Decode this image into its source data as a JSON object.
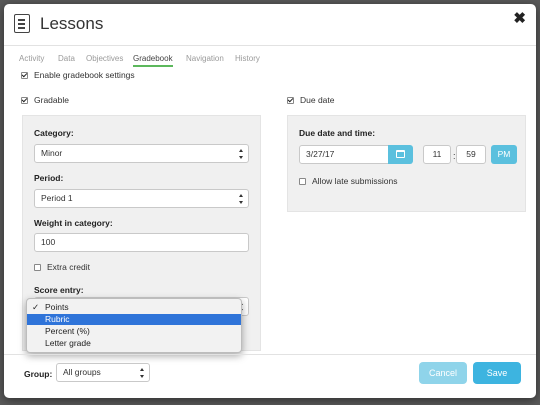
{
  "header": {
    "title": "Lessons",
    "close": "✖"
  },
  "tabs": [
    {
      "label": "Activity"
    },
    {
      "label": "Data"
    },
    {
      "label": "Objectives"
    },
    {
      "label": "Gradebook"
    },
    {
      "label": "Navigation"
    },
    {
      "label": "History"
    }
  ],
  "active_tab": "Gradebook",
  "settings": {
    "enable_gradebook": {
      "label": "Enable gradebook settings",
      "checked": true
    },
    "gradable": {
      "label": "Gradable",
      "checked": true
    },
    "due_date": {
      "label": "Due date",
      "checked": true
    }
  },
  "gradable_panel": {
    "category_label": "Category:",
    "category_value": "Minor",
    "period_label": "Period:",
    "period_value": "Period 1",
    "weight_label": "Weight in category:",
    "weight_value": "100",
    "extra_credit": {
      "label": "Extra credit",
      "checked": false
    },
    "score_entry_label": "Score entry:",
    "score_options": [
      {
        "label": "Points",
        "checked": true
      },
      {
        "label": "Rubric",
        "highlighted": true
      },
      {
        "label": "Percent (%)"
      },
      {
        "label": "Letter grade"
      }
    ]
  },
  "due_panel": {
    "label": "Due date and time:",
    "date": "3/27/17",
    "hour": "11",
    "minute": "59",
    "ampm": "PM",
    "allow_late": {
      "label": "Allow late submissions",
      "checked": false
    }
  },
  "footer": {
    "group_label": "Group:",
    "group_value": "All groups",
    "cancel": "Cancel",
    "save": "Save"
  },
  "colors": {
    "accent": "#5bc0de",
    "tab_underline": "#5cb85c",
    "cancel_bg": "#8fd4ea",
    "save_bg": "#3db4e0",
    "selection": "#2f74d9"
  }
}
